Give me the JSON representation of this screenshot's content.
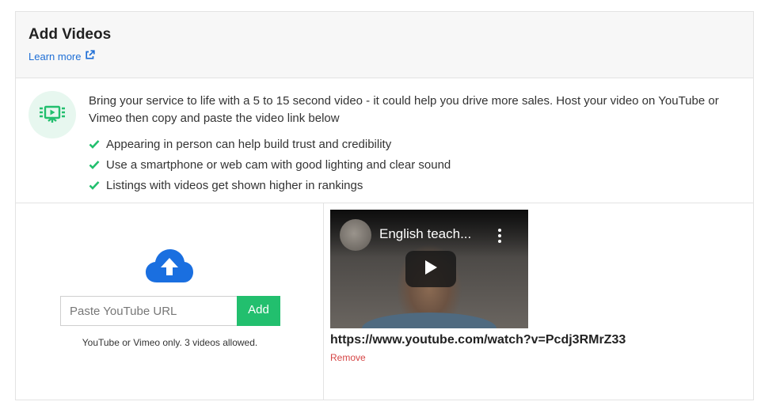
{
  "header": {
    "title": "Add Videos",
    "learn_more": "Learn more"
  },
  "info": {
    "intro": "Bring your service to life with a 5 to 15 second video - it could help you drive more sales. Host your video on YouTube or Vimeo then copy and paste the video link below",
    "bullets": [
      "Appearing in person can help build trust and credibility",
      "Use a smartphone or web cam with good lighting and clear sound",
      "Listings with videos get shown higher in rankings"
    ]
  },
  "uploader": {
    "placeholder": "Paste YouTube URL",
    "add_label": "Add",
    "hint": "YouTube or Vimeo only. 3 videos allowed."
  },
  "video": {
    "title": "English teach...",
    "url": "https://www.youtube.com/watch?v=Pcdj3RMrZ33",
    "remove_label": "Remove"
  },
  "colors": {
    "accent_green": "#22bf6e",
    "link_blue": "#1f6fd6",
    "remove_red": "#d64545",
    "cloud_blue": "#1a6fe0"
  },
  "icons": {
    "external": "external-link-icon",
    "badge": "video-presentation-icon",
    "check": "check-icon",
    "cloud": "cloud-upload-icon",
    "play": "play-icon"
  }
}
